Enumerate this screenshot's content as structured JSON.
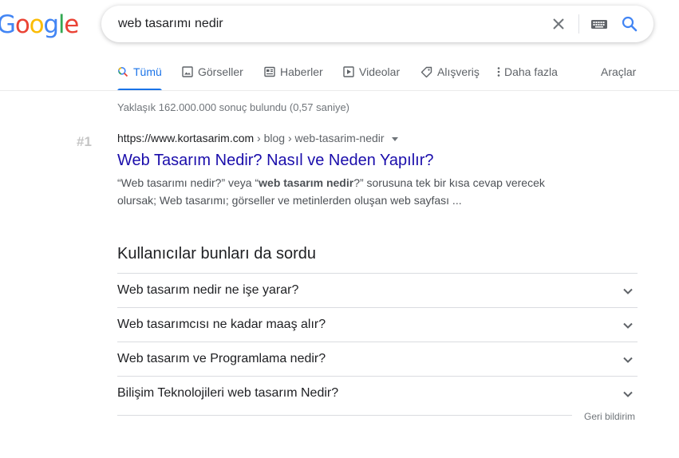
{
  "logo": {
    "letters": [
      {
        "ch": "G",
        "color": "#4285F4"
      },
      {
        "ch": "o",
        "color": "#EA4335"
      },
      {
        "ch": "o",
        "color": "#FBBC05"
      },
      {
        "ch": "g",
        "color": "#4285F4"
      },
      {
        "ch": "l",
        "color": "#34A853"
      },
      {
        "ch": "e",
        "color": "#EA4335"
      }
    ]
  },
  "search": {
    "query": "web tasarımı nedir",
    "icons": [
      "close-icon",
      "keyboard-icon",
      "search-icon"
    ]
  },
  "tabs": [
    {
      "label": "Tümü",
      "icon": "search-icon",
      "active": true
    },
    {
      "label": "Görseller",
      "icon": "image-icon"
    },
    {
      "label": "Haberler",
      "icon": "news-icon"
    },
    {
      "label": "Videolar",
      "icon": "video-icon"
    },
    {
      "label": "Alışveriş",
      "icon": "tag-icon"
    },
    {
      "label": "Daha fazla",
      "icon": "more-vert-icon"
    }
  ],
  "tools_label": "Araçlar",
  "stats": "Yaklaşık 162.000.000 sonuç bulundu (0,57 saniye)",
  "result": {
    "rank": "#1",
    "domain": "https://www.kortasarim.com",
    "path": " › blog › web-tasarim-nedir",
    "title": "Web Tasarım Nedir? Nasıl ve Neden Yapılır?",
    "snippet_parts": [
      {
        "text": "“Web tasarımı nedir?” veya “",
        "bold": false
      },
      {
        "text": "web tasarım nedir",
        "bold": true
      },
      {
        "text": "?” sorusuna tek bir kısa cevap verecek olursak; Web tasarımı; görseller ve metinlerden oluşan web sayfası ...",
        "bold": false
      }
    ]
  },
  "people_also_ask": {
    "heading": "Kullanıcılar bunları da sordu",
    "questions": [
      "Web tasarım nedir ne işe yarar?",
      "Web tasarımcısı ne kadar maaş alır?",
      "Web tasarım ve Programlama nedir?",
      "Bilişim Teknolojileri web tasarım Nedir?"
    ]
  },
  "feedback_label": "Geri bildirim"
}
